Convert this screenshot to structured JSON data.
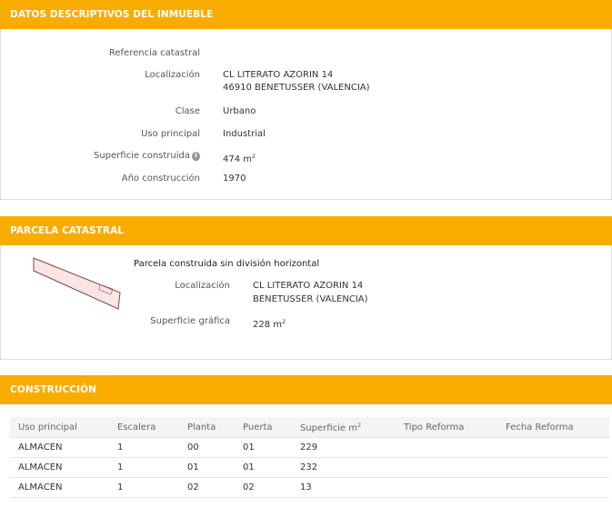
{
  "sections": {
    "inmueble": {
      "title": "DATOS DESCRIPTIVOS DEL INMUEBLE",
      "referencia_label": "Referencia catastral",
      "referencia_value": "",
      "localizacion_label": "Localización",
      "localizacion_line1": "CL LITERATO AZORIN 14",
      "localizacion_line2": "46910 BENETUSSER (VALENCIA)",
      "clase_label": "Clase",
      "clase_value": "Urbano",
      "uso_label": "Uso principal",
      "uso_value": "Industrial",
      "superficie_label": "Superficie construida",
      "superficie_value": "474",
      "superficie_unit": "m",
      "superficie_unit_exp": "2",
      "anio_label": "Año construcción",
      "anio_value": "1970",
      "info_icon": "info-icon"
    },
    "parcela": {
      "title": "PARCELA CATASTRAL",
      "subtitle": "Parcela construida sin división horizontal",
      "localizacion_label": "Localización",
      "localizacion_line1": "CL LITERATO AZORIN 14",
      "localizacion_line2": "BENETUSSER (VALENCIA)",
      "superficie_label": "Superficie gráfica",
      "superficie_value": "228",
      "superficie_unit": "m",
      "superficie_unit_exp": "2",
      "map_icon": "parcel-outline-icon"
    },
    "construccion": {
      "title": "CONSTRUCCIÓN",
      "columns": [
        "Uso principal",
        "Escalera",
        "Planta",
        "Puerta",
        "Superficie m",
        "Tipo Reforma",
        "Fecha Reforma"
      ],
      "superficie_col_exp": "2",
      "rows": [
        [
          "ALMACEN",
          "1",
          "00",
          "01",
          "229",
          "",
          ""
        ],
        [
          "ALMACEN",
          "1",
          "01",
          "01",
          "232",
          "",
          ""
        ],
        [
          "ALMACEN",
          "1",
          "02",
          "02",
          "13",
          "",
          ""
        ]
      ]
    }
  },
  "colors": {
    "header_bg": "#f9ac00",
    "parcel_fill": "#fbe4e4",
    "parcel_stroke": "#7a4a4a"
  }
}
